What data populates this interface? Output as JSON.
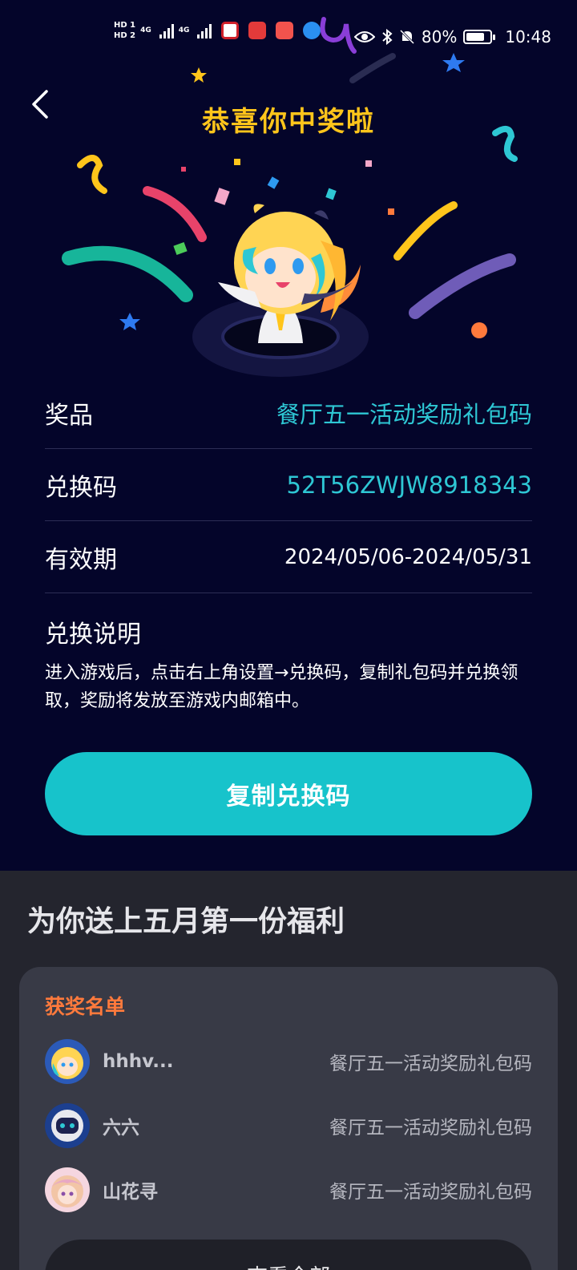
{
  "status_bar": {
    "hd1": "HD 1",
    "hd2": "HD 2",
    "net1": "4G",
    "net2": "4G",
    "battery": "80%",
    "time": "10:48"
  },
  "header": {
    "title": "恭喜你中奖啦"
  },
  "prize": {
    "prize_label": "奖品",
    "prize_value": "餐厅五一活动奖励礼包码",
    "code_label": "兑换码",
    "code_value": "52T56ZWJW8918343",
    "valid_label": "有效期",
    "valid_value": "2024/05/06-2024/05/31",
    "desc_title": "兑换说明",
    "desc_text": "进入游戏后，点击右上角设置→兑换码，复制礼包码并兑换领取，奖励将发放至游戏内邮箱中。"
  },
  "copy_button": "复制兑换码",
  "welfare": {
    "title": "为你送上五月第一份福利",
    "list_title": "获奖名单",
    "winners": [
      {
        "name": "hhhv...",
        "prize": "餐厅五一活动奖励礼包码"
      },
      {
        "name": "六六",
        "prize": "餐厅五一活动奖励礼包码"
      },
      {
        "name": "山花寻",
        "prize": "餐厅五一活动奖励礼包码"
      }
    ],
    "view_all": "查看全部"
  },
  "colors": {
    "background": "#04052a",
    "title": "#ffc51b",
    "accent": "#17c3cb",
    "list_title": "#ff7a3c"
  }
}
